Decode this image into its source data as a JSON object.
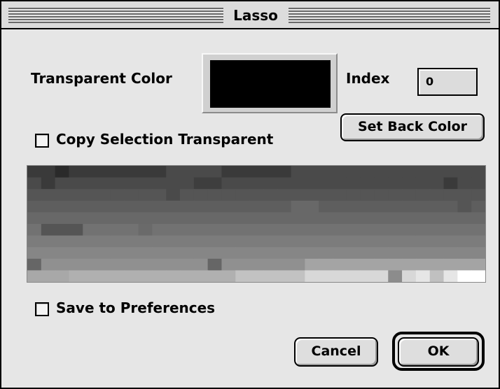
{
  "window": {
    "title": "Lasso"
  },
  "transparent_color": {
    "label": "Transparent Color",
    "swatch_color": "#000000"
  },
  "index": {
    "label": "Index",
    "value": "0"
  },
  "buttons": {
    "set_back_color": "Set Back Color",
    "cancel": "Cancel",
    "ok": "OK"
  },
  "checkboxes": {
    "copy_selection_transparent": {
      "label": "Copy Selection Transparent",
      "checked": false
    },
    "save_to_preferences": {
      "label": "Save to Preferences",
      "checked": false
    }
  },
  "preview": {
    "description_icon": "pixel-preview",
    "shades": [
      [
        "#3a3a3a",
        "#3a3a3a",
        "#2a2a2a",
        "#3a3a3a",
        "#3a3a3a",
        "#3a3a3a",
        "#3a3a3a",
        "#3a3a3a",
        "#3a3a3a",
        "#3a3a3a",
        "#4a4a4a",
        "#4a4a4a",
        "#4a4a4a",
        "#4a4a4a",
        "#3a3a3a",
        "#3a3a3a",
        "#3a3a3a",
        "#3a3a3a",
        "#3a3a3a",
        "#4a4a4a",
        "#4a4a4a",
        "#4a4a4a",
        "#4a4a4a",
        "#4a4a4a",
        "#4a4a4a",
        "#4a4a4a",
        "#4a4a4a",
        "#4a4a4a",
        "#4a4a4a",
        "#4a4a4a",
        "#4a4a4a",
        "#4a4a4a",
        "#4a4a4a"
      ],
      [
        "#4a4a4a",
        "#3a3a3a",
        "#4a4a4a",
        "#4a4a4a",
        "#4a4a4a",
        "#4a4a4a",
        "#4a4a4a",
        "#4a4a4a",
        "#4a4a4a",
        "#4a4a4a",
        "#4a4a4a",
        "#4a4a4a",
        "#3e3e3e",
        "#3e3e3e",
        "#4a4a4a",
        "#4a4a4a",
        "#4a4a4a",
        "#4a4a4a",
        "#4a4a4a",
        "#4a4a4a",
        "#4a4a4a",
        "#4a4a4a",
        "#4a4a4a",
        "#4a4a4a",
        "#4a4a4a",
        "#4a4a4a",
        "#4a4a4a",
        "#4a4a4a",
        "#4a4a4a",
        "#4a4a4a",
        "#3a3a3a",
        "#4a4a4a",
        "#4a4a4a"
      ],
      [
        "#555555",
        "#555555",
        "#555555",
        "#555555",
        "#555555",
        "#555555",
        "#555555",
        "#555555",
        "#555555",
        "#555555",
        "#4a4a4a",
        "#555555",
        "#555555",
        "#555555",
        "#555555",
        "#555555",
        "#555555",
        "#555555",
        "#555555",
        "#555555",
        "#555555",
        "#555555",
        "#555555",
        "#555555",
        "#555555",
        "#555555",
        "#555555",
        "#555555",
        "#555555",
        "#555555",
        "#555555",
        "#555555",
        "#555555"
      ],
      [
        "#5e5e5e",
        "#5e5e5e",
        "#5e5e5e",
        "#5e5e5e",
        "#5e5e5e",
        "#5e5e5e",
        "#5e5e5e",
        "#5e5e5e",
        "#5e5e5e",
        "#5e5e5e",
        "#5e5e5e",
        "#5e5e5e",
        "#5e5e5e",
        "#5e5e5e",
        "#5e5e5e",
        "#5e5e5e",
        "#5e5e5e",
        "#5e5e5e",
        "#5e5e5e",
        "#686868",
        "#686868",
        "#5e5e5e",
        "#5e5e5e",
        "#5e5e5e",
        "#5e5e5e",
        "#5e5e5e",
        "#5e5e5e",
        "#5e5e5e",
        "#5e5e5e",
        "#5e5e5e",
        "#5e5e5e",
        "#555555",
        "#5e5e5e"
      ],
      [
        "#686868",
        "#686868",
        "#686868",
        "#686868",
        "#686868",
        "#686868",
        "#686868",
        "#686868",
        "#686868",
        "#686868",
        "#686868",
        "#686868",
        "#686868",
        "#686868",
        "#686868",
        "#686868",
        "#686868",
        "#686868",
        "#686868",
        "#686868",
        "#686868",
        "#686868",
        "#686868",
        "#686868",
        "#686868",
        "#686868",
        "#686868",
        "#686868",
        "#686868",
        "#686868",
        "#686868",
        "#686868",
        "#686868"
      ],
      [
        "#727272",
        "#555555",
        "#555555",
        "#555555",
        "#727272",
        "#727272",
        "#727272",
        "#727272",
        "#6a6a6a",
        "#727272",
        "#727272",
        "#727272",
        "#727272",
        "#727272",
        "#727272",
        "#727272",
        "#727272",
        "#727272",
        "#727272",
        "#727272",
        "#727272",
        "#727272",
        "#727272",
        "#727272",
        "#727272",
        "#727272",
        "#727272",
        "#727272",
        "#727272",
        "#727272",
        "#727272",
        "#727272",
        "#727272"
      ],
      [
        "#7c7c7c",
        "#7c7c7c",
        "#7c7c7c",
        "#7c7c7c",
        "#7c7c7c",
        "#7c7c7c",
        "#7c7c7c",
        "#7c7c7c",
        "#7c7c7c",
        "#7c7c7c",
        "#7c7c7c",
        "#7c7c7c",
        "#7c7c7c",
        "#7c7c7c",
        "#7c7c7c",
        "#7c7c7c",
        "#7c7c7c",
        "#7c7c7c",
        "#7c7c7c",
        "#7c7c7c",
        "#7c7c7c",
        "#7c7c7c",
        "#7c7c7c",
        "#7c7c7c",
        "#7c7c7c",
        "#7c7c7c",
        "#7c7c7c",
        "#7c7c7c",
        "#7c7c7c",
        "#7c7c7c",
        "#7c7c7c",
        "#7c7c7c",
        "#7c7c7c"
      ],
      [
        "#868686",
        "#868686",
        "#868686",
        "#868686",
        "#868686",
        "#868686",
        "#868686",
        "#868686",
        "#868686",
        "#868686",
        "#868686",
        "#868686",
        "#868686",
        "#868686",
        "#868686",
        "#868686",
        "#868686",
        "#868686",
        "#868686",
        "#868686",
        "#868686",
        "#868686",
        "#868686",
        "#868686",
        "#868686",
        "#868686",
        "#868686",
        "#868686",
        "#868686",
        "#868686",
        "#868686",
        "#868686",
        "#868686"
      ],
      [
        "#666666",
        "#909090",
        "#909090",
        "#909090",
        "#909090",
        "#909090",
        "#909090",
        "#909090",
        "#909090",
        "#909090",
        "#909090",
        "#909090",
        "#909090",
        "#666666",
        "#909090",
        "#909090",
        "#909090",
        "#909090",
        "#909090",
        "#909090",
        "#a4a4a4",
        "#a4a4a4",
        "#a4a4a4",
        "#a4a4a4",
        "#a4a4a4",
        "#a4a4a4",
        "#a4a4a4",
        "#a4a4a4",
        "#a4a4a4",
        "#a4a4a4",
        "#a4a4a4",
        "#a4a4a4",
        "#a4a4a4"
      ],
      [
        "#a8a8a8",
        "#a8a8a8",
        "#a8a8a8",
        "#b0b0b0",
        "#b0b0b0",
        "#b0b0b0",
        "#b0b0b0",
        "#b0b0b0",
        "#b0b0b0",
        "#b0b0b0",
        "#b0b0b0",
        "#b0b0b0",
        "#b0b0b0",
        "#b0b0b0",
        "#b0b0b0",
        "#c2c2c2",
        "#c2c2c2",
        "#c2c2c2",
        "#c2c2c2",
        "#c2c2c2",
        "#d8d8d8",
        "#d8d8d8",
        "#d8d8d8",
        "#d8d8d8",
        "#d8d8d8",
        "#d8d8d8",
        "#8c8c8c",
        "#d8d8d8",
        "#e6e6e6",
        "#c0c0c0",
        "#e6e6e6",
        "#ffffff",
        "#ffffff"
      ]
    ]
  }
}
